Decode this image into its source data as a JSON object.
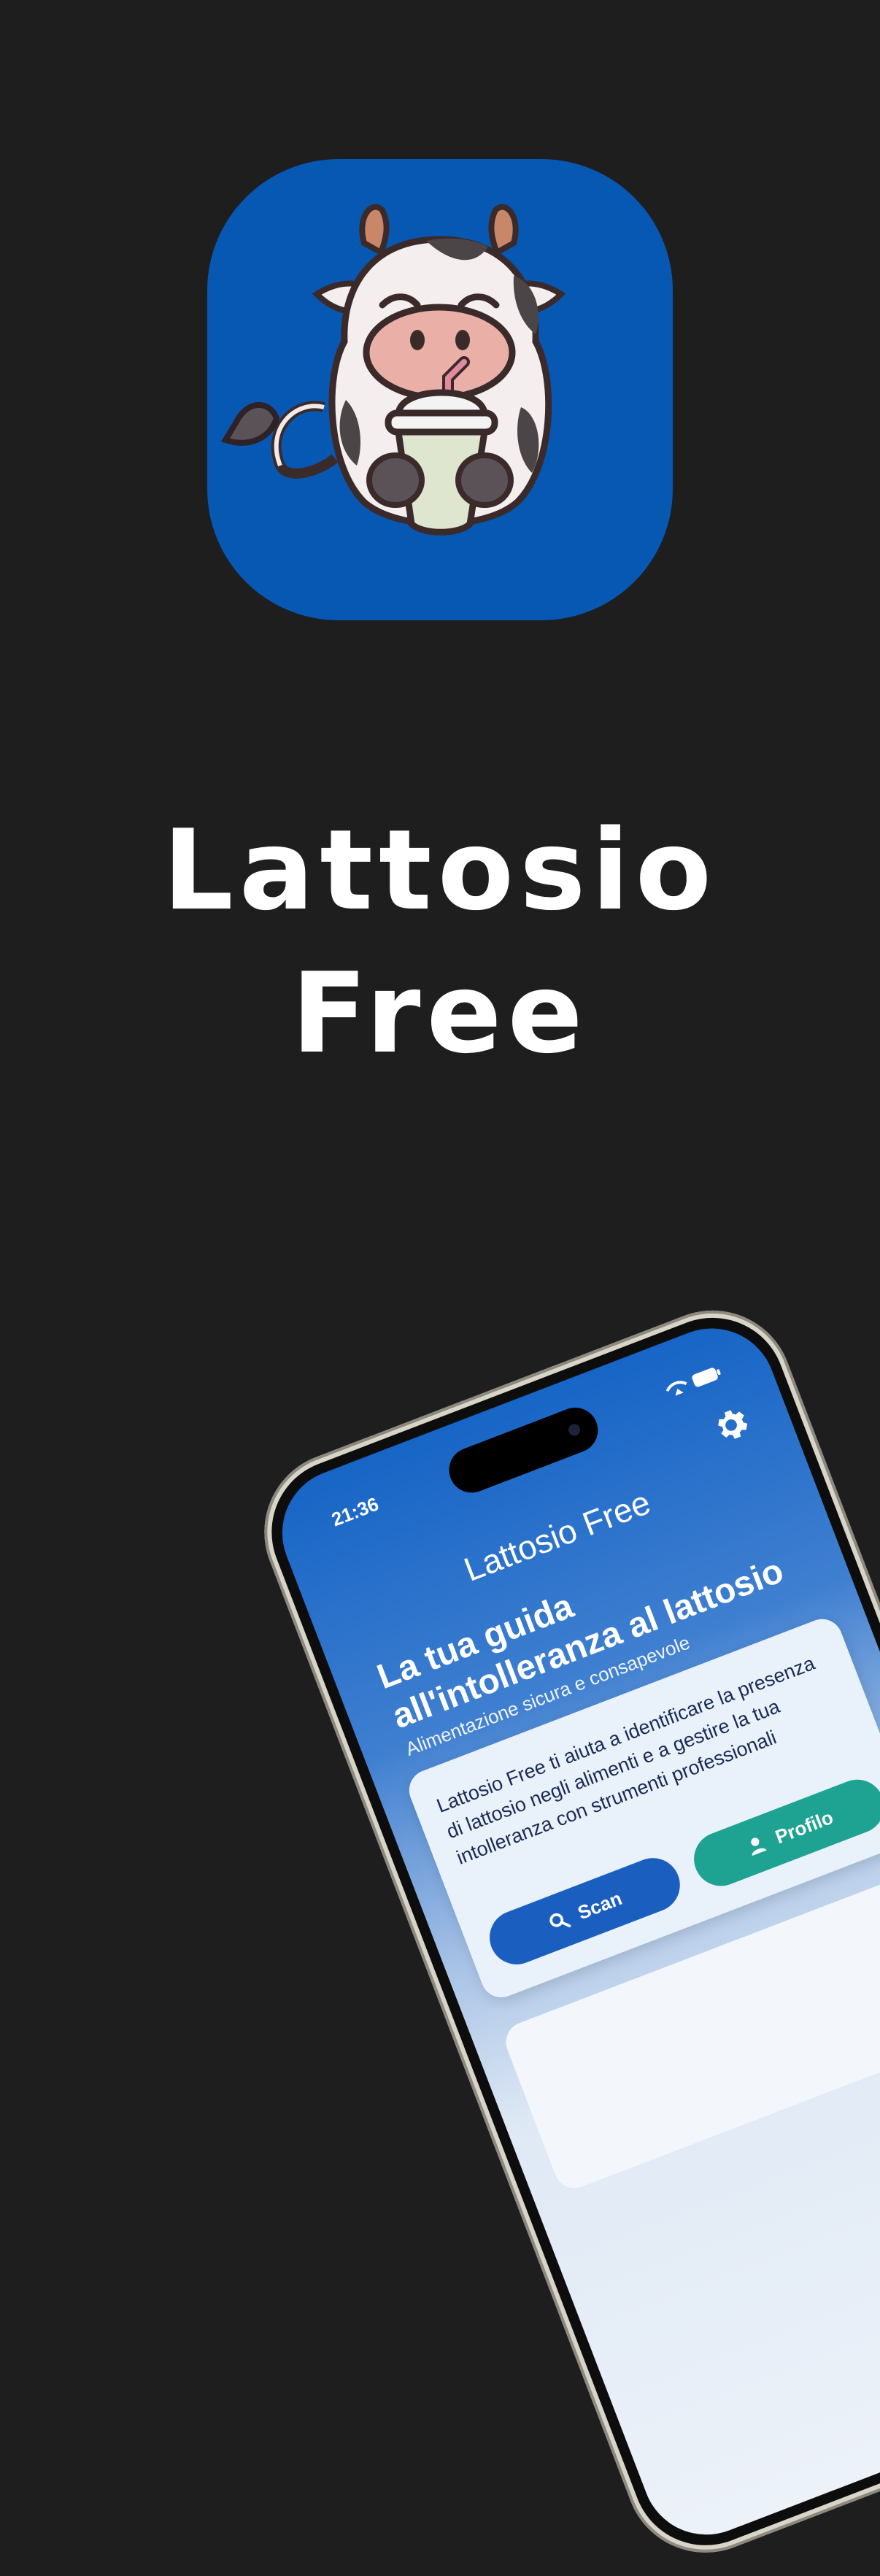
{
  "brand": {
    "app_name_line1": "Lattosio",
    "app_name_line2": "Free",
    "icon_background": "#0758b3",
    "page_background": "#1e1e1e"
  },
  "phone": {
    "status_bar": {
      "time": "21:36"
    },
    "nav_title": "Lattosio Free",
    "hero": {
      "title": "La tua guida all'intolleranza al lattosio",
      "subtitle": "Alimentazione sicura e consapevole"
    },
    "card": {
      "text": "Lattosio Free ti aiuta a identificare la presenza di lattosio negli alimenti e a gestire la tua intolleranza con strumenti professionali",
      "scan_label": "Scan",
      "profile_label": "Profilo"
    },
    "colors": {
      "primary": "#1a5fbf",
      "accent": "#1ea392"
    },
    "icons": [
      "settings-gear-icon",
      "search-icon",
      "person-icon",
      "wifi-icon",
      "battery-icon"
    ]
  }
}
